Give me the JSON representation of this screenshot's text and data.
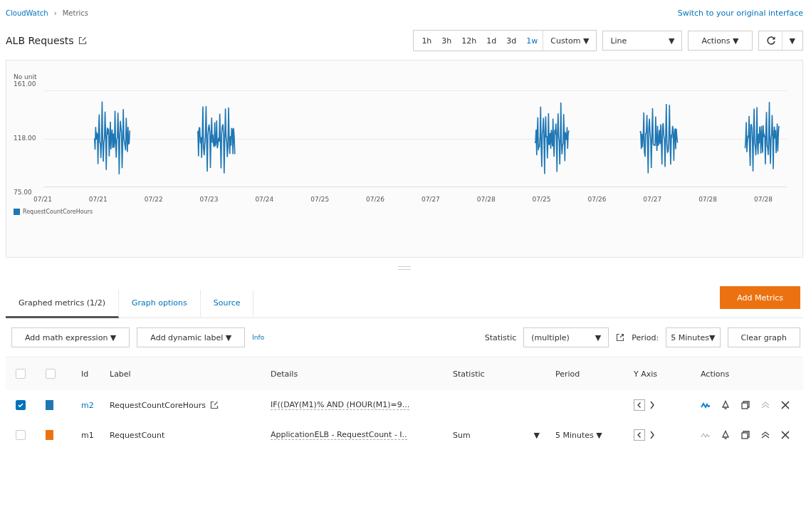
{
  "breadcrumb": [
    {
      "label": "CloudWatch",
      "link": true
    },
    {
      "label": "Metrics",
      "link": false
    }
  ],
  "breadcrumb_separator": "›",
  "switch_link": "Switch to your original interface",
  "title": "ALB Requests",
  "time_ranges": [
    {
      "label": "1h",
      "selected": false
    },
    {
      "label": "3h",
      "selected": false
    },
    {
      "label": "12h",
      "selected": false
    },
    {
      "label": "1d",
      "selected": false
    },
    {
      "label": "3d",
      "selected": false
    },
    {
      "label": "1w",
      "selected": true
    }
  ],
  "custom_button": "Custom ▼",
  "graph_type": {
    "value": "Line",
    "caret": "▼"
  },
  "actions_button": "Actions ▼",
  "refresh_caret": "▼",
  "graph": {
    "unit": "No unit",
    "y_ticks": [
      "161.00",
      "118.00",
      "75.00"
    ],
    "x_labels": [
      "07/21",
      "07/21",
      "07/22",
      "07/23",
      "07/24",
      "07/25",
      "07/26",
      "07/27",
      "07/28",
      "07/25",
      "07/26",
      "07/27",
      "07/28",
      "07/28"
    ],
    "legend": [
      {
        "label": "RequestCountCoreHours",
        "color": "#1f77b4"
      }
    ]
  },
  "tabs": [
    {
      "label": "Graphed metrics (1/2)",
      "selected": true
    },
    {
      "label": "Graph options",
      "selected": false
    },
    {
      "label": "Source",
      "selected": false
    }
  ],
  "add_metrics": "Add Metrics",
  "toolbar": {
    "math": "Add math expression ▼",
    "dynamic": "Add dynamic label ▼",
    "info": "Info",
    "statistic_label": "Statistic",
    "statistic_value": "(multiple)",
    "statistic_caret": "▼",
    "period_label": "Period:",
    "period_value": "5 Minutes▼",
    "clear": "Clear graph"
  },
  "table": {
    "header_checkboxes": [
      {
        "checked": false
      },
      {
        "checked": false
      }
    ],
    "columns": [
      "Id",
      "Label",
      "Details",
      "Statistic",
      "Period",
      "Y Axis",
      "Actions"
    ],
    "rows": [
      {
        "checked": true,
        "color": "#1f77b4",
        "id": "m2",
        "id_link": true,
        "label": "RequestCountCoreHours",
        "editable": true,
        "details": "IF((DAY(M1)% AND (HOUR(M1)=9...",
        "graph_active": true,
        "move_up_disabled": true
      },
      {
        "checked": false,
        "color": "#ec7211",
        "id": "m1",
        "id_link": false,
        "label": "RequestCount",
        "editable": false,
        "details": "ApplicationELB - RequestCount - I..",
        "statistic": "Sum",
        "statistic_caret": "▼",
        "period": "5 Minutes ▼",
        "graph_active": false,
        "move_up_disabled": false
      }
    ]
  }
}
